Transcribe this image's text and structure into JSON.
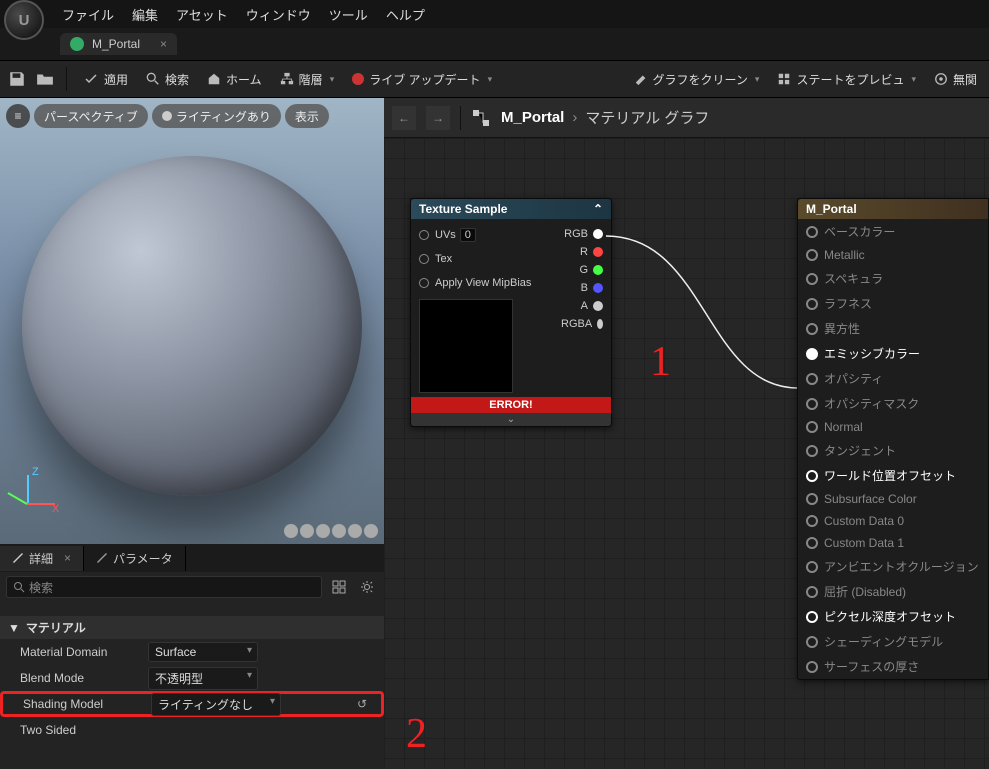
{
  "menu": [
    "ファイル",
    "編集",
    "アセット",
    "ウィンドウ",
    "ツール",
    "ヘルプ"
  ],
  "tab": {
    "title": "M_Portal"
  },
  "toolbar": {
    "apply": "適用",
    "search": "検索",
    "home": "ホーム",
    "hierarchy": "階層",
    "live": "ライブ アップデート",
    "clean": "グラフをクリーン",
    "preview": "ステートをプレビュ",
    "unrelated": "無関"
  },
  "viewport": {
    "perspective": "パースペクティブ",
    "lighting": "ライティングあり",
    "display": "表示",
    "axes": {
      "z": "Z",
      "x": "X"
    }
  },
  "detailsTabs": {
    "details": "詳細",
    "params": "パラメータ"
  },
  "searchPlaceholder": "検索",
  "category": "マテリアル",
  "props": {
    "domain": {
      "label": "Material Domain",
      "value": "Surface"
    },
    "blend": {
      "label": "Blend Mode",
      "value": "不透明型"
    },
    "shading": {
      "label": "Shading Model",
      "value": "ライティングなし"
    },
    "twoSided": {
      "label": "Two Sided"
    }
  },
  "graph": {
    "back": "←",
    "fwd": "→",
    "breadcrumb": {
      "name": "M_Portal",
      "sub": "マテリアル グラフ"
    }
  },
  "node": {
    "title": "Texture Sample",
    "inputs": [
      "UVs",
      "Tex",
      "Apply View MipBias"
    ],
    "uvDefault": "0",
    "outputs": [
      {
        "label": "RGB",
        "color": "#fff"
      },
      {
        "label": "R",
        "color": "#f44"
      },
      {
        "label": "G",
        "color": "#4f4"
      },
      {
        "label": "B",
        "color": "#55f"
      },
      {
        "label": "A",
        "color": "#ccc"
      },
      {
        "label": "RGBA",
        "color": "#ccc"
      }
    ],
    "error": "ERROR!"
  },
  "result": {
    "title": "M_Portal",
    "pins": [
      {
        "label": "ベースカラー",
        "active": false
      },
      {
        "label": "Metallic",
        "active": false
      },
      {
        "label": "スペキュラ",
        "active": false
      },
      {
        "label": "ラフネス",
        "active": false
      },
      {
        "label": "異方性",
        "active": false
      },
      {
        "label": "エミッシブカラー",
        "active": true,
        "filled": true
      },
      {
        "label": "オパシティ",
        "active": false
      },
      {
        "label": "オパシティマスク",
        "active": false
      },
      {
        "label": "Normal",
        "active": false
      },
      {
        "label": "タンジェント",
        "active": false
      },
      {
        "label": "ワールド位置オフセット",
        "active": true
      },
      {
        "label": "Subsurface Color",
        "active": false
      },
      {
        "label": "Custom Data 0",
        "active": false
      },
      {
        "label": "Custom Data 1",
        "active": false
      },
      {
        "label": "アンビエントオクルージョン",
        "active": false
      },
      {
        "label": "屈折 (Disabled)",
        "active": false
      },
      {
        "label": "ピクセル深度オフセット",
        "active": true
      },
      {
        "label": "シェーディングモデル",
        "active": false
      },
      {
        "label": "サーフェスの厚さ",
        "active": false
      }
    ]
  },
  "annot": {
    "one": "1",
    "two": "2"
  }
}
